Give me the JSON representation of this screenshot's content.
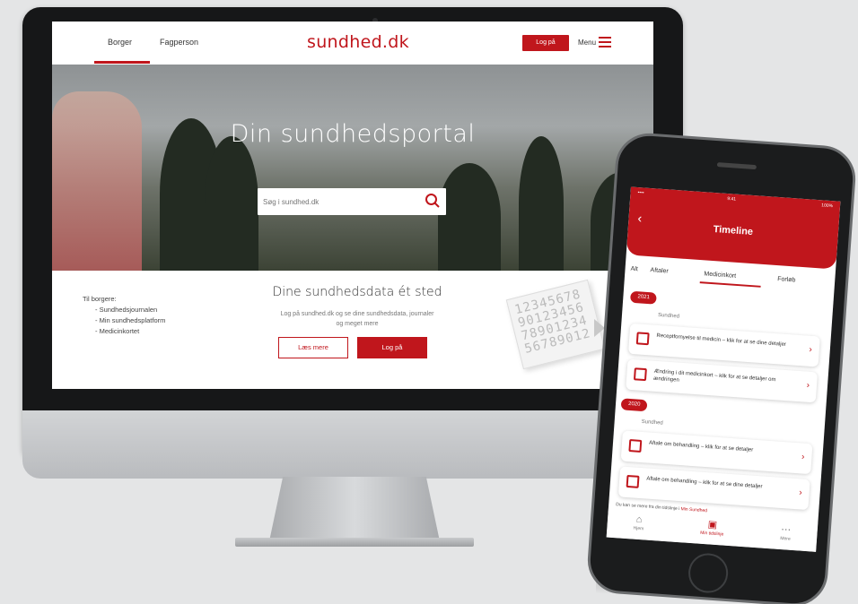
{
  "desktop": {
    "nav": {
      "tab_citizen": "Borger",
      "tab_professional": "Fagperson",
      "logo": "sundhed.dk",
      "login": "Log på",
      "menu": "Menu"
    },
    "hero": {
      "title": "Din sundhedsportal",
      "search_placeholder": "Søg i sundhed.dk"
    },
    "info": {
      "intro": "Til borgere:",
      "items": [
        "- Sundhedsjournalen",
        "- Min sundhedsplatform",
        "- Medicinkortet"
      ],
      "title": "Dine sundhedsdata ét sted",
      "subtitle_line1": "Log på sundhed.dk og se dine sundhedsdata, journaler",
      "subtitle_line2": "og meget mere",
      "btn_more": "Læs mere",
      "btn_login": "Log på"
    },
    "numbers_art": "12345678 90123456 78901234 56789012"
  },
  "phone": {
    "status": {
      "carrier": "•••• ",
      "time": "9:41",
      "battery": "100%"
    },
    "title": "Timeline",
    "tabs": [
      "Alt",
      "Aftaler",
      "Medicinkort",
      "Forløb"
    ],
    "active_tab": "Medicinkort",
    "groups": [
      {
        "year": "2021",
        "label": "Sundhed",
        "cards": [
          {
            "text": "Receptfornyelse til medicin – klik for at se dine detaljer"
          },
          {
            "text": "Ændring i dit medicinkort – klik for at se detaljer om ændringen"
          }
        ]
      },
      {
        "year": "2020",
        "label": "Sundhed",
        "cards": [
          {
            "text": "Aftale om behandling – klik for at se detaljer"
          },
          {
            "text": "Aftale om behandling – klik for at se dine detaljer"
          }
        ]
      }
    ],
    "footnote": "Du kan se mere fra din tidslinje i",
    "footnote_link": "Min Sundhed",
    "tabbar": [
      {
        "icon": "home-icon",
        "glyph": "⌂",
        "label": "Hjem"
      },
      {
        "icon": "calendar-icon",
        "glyph": "▣",
        "label": "Min tidslinje"
      },
      {
        "icon": "more-icon",
        "glyph": "⋯",
        "label": "Mere"
      }
    ]
  },
  "colors": {
    "brand_red": "#c0161c"
  }
}
